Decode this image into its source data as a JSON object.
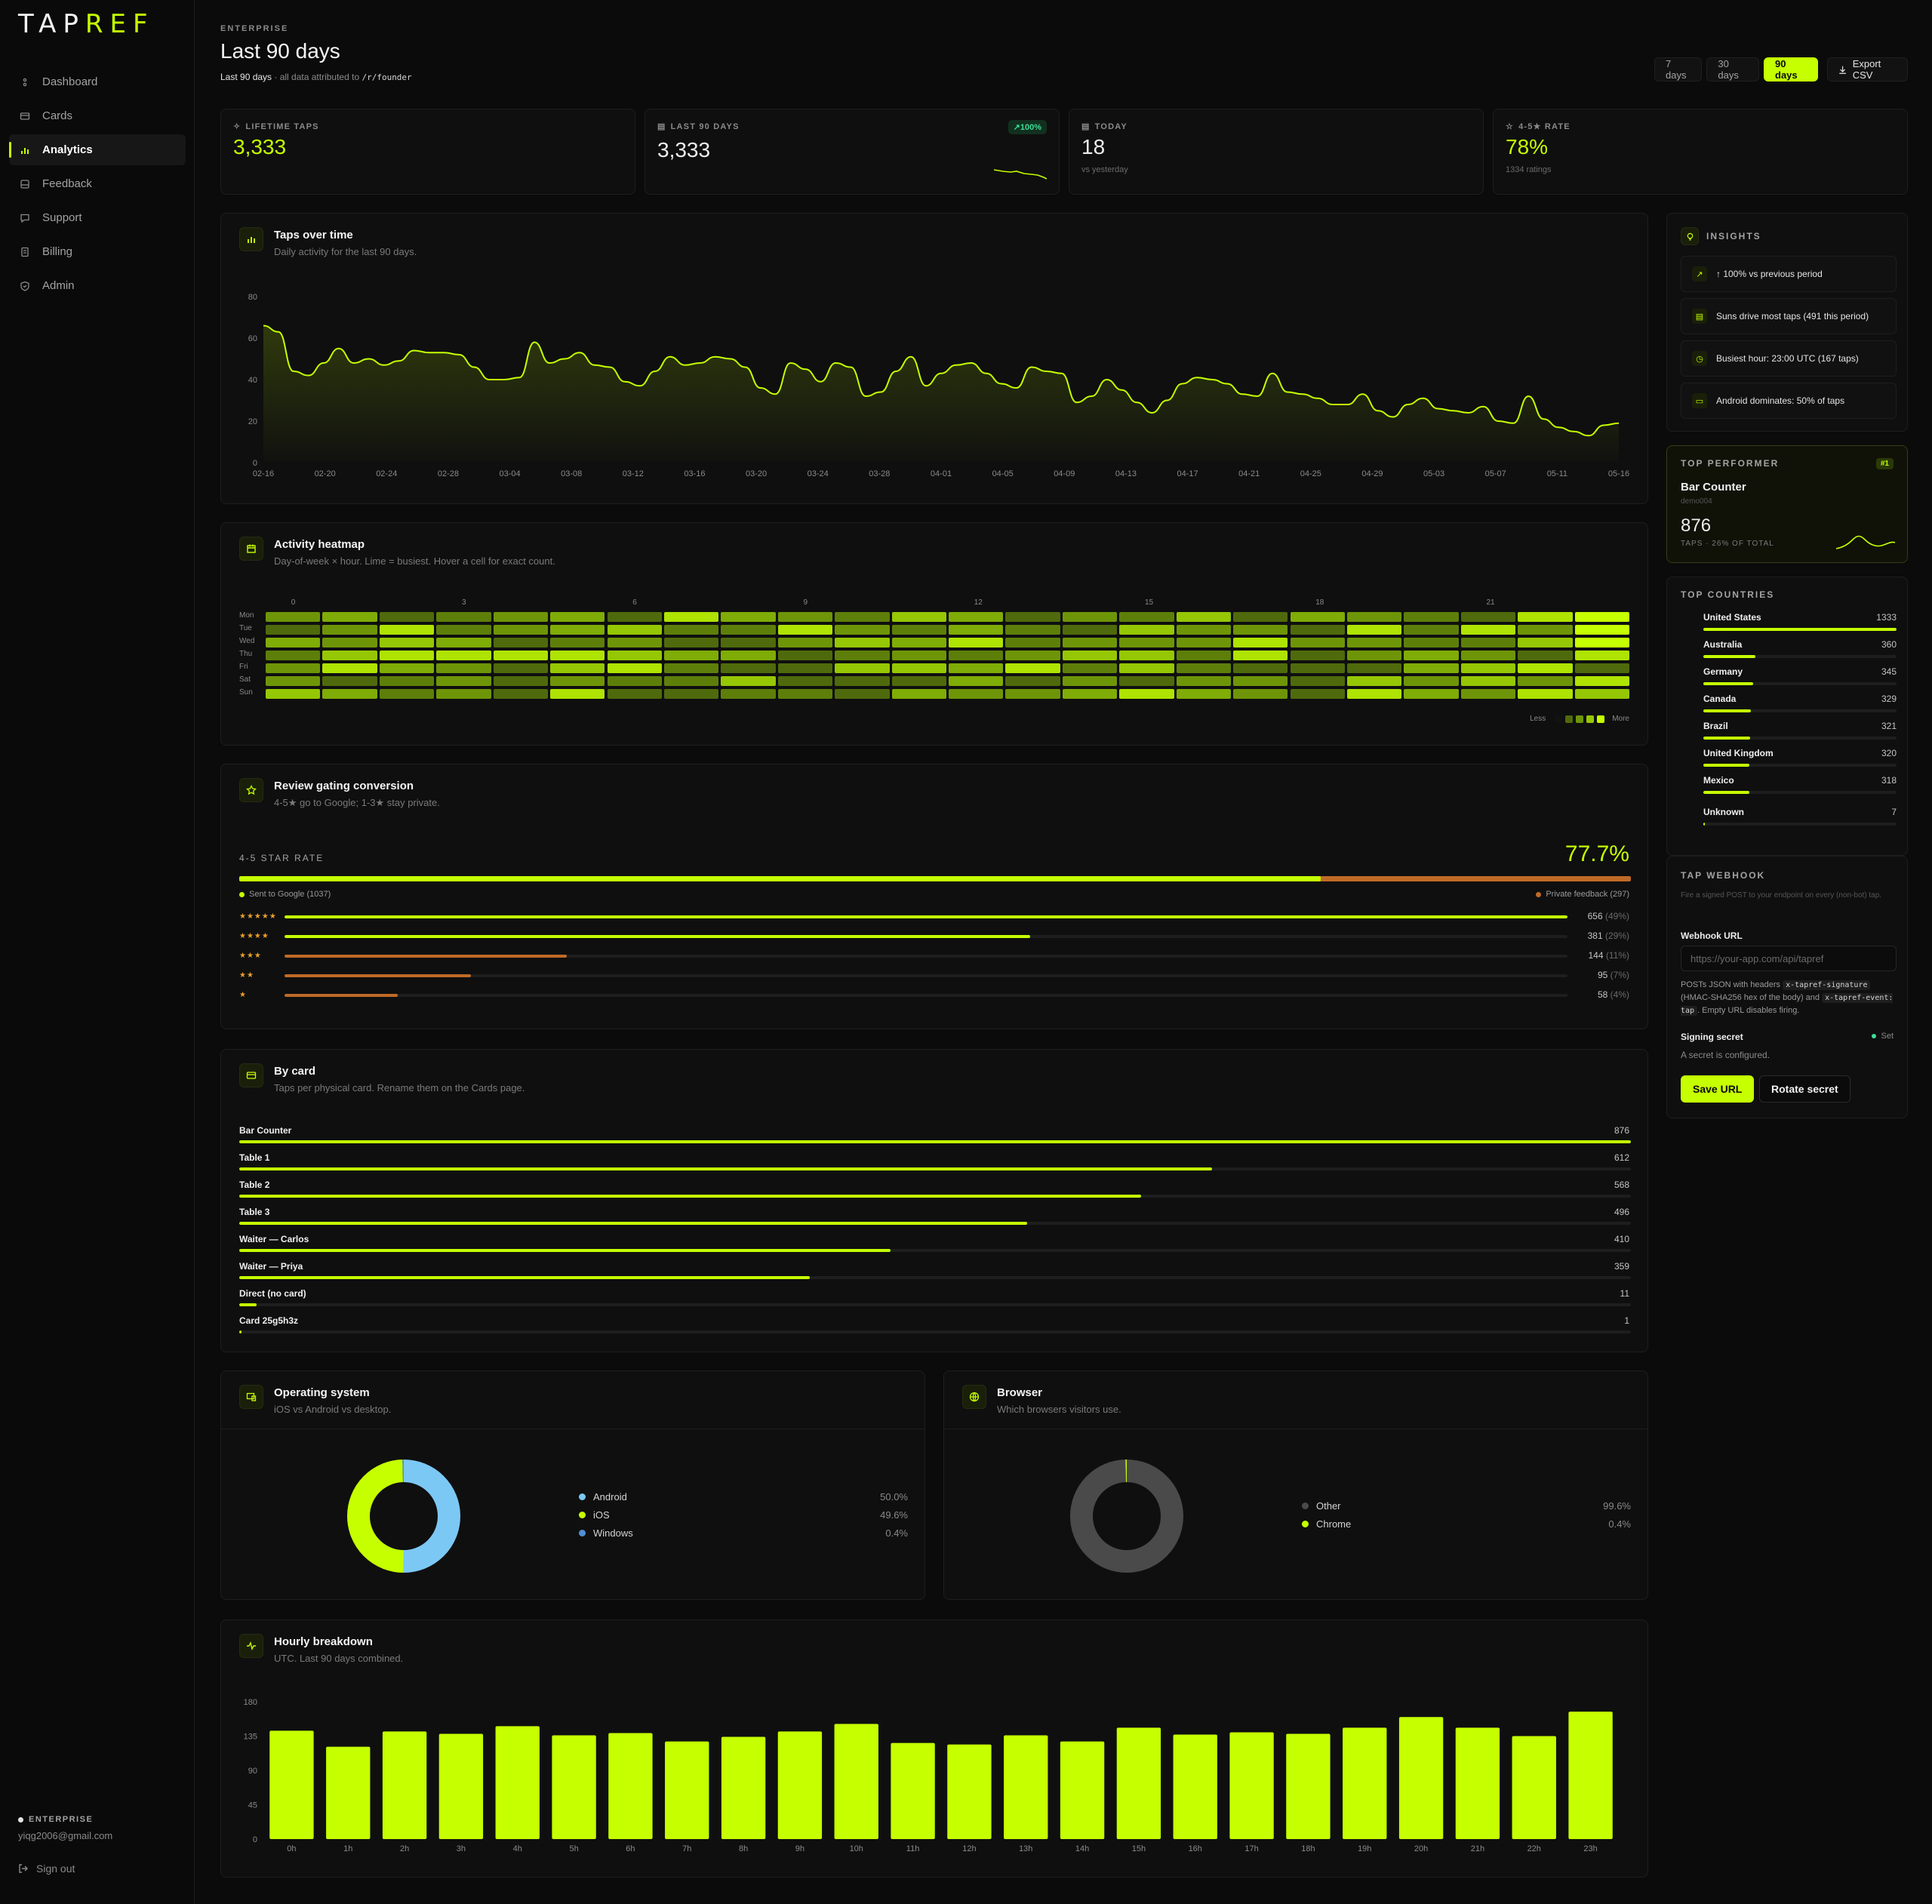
{
  "brand": {
    "logo_a": "TAP",
    "logo_b": "REF"
  },
  "nav": [
    {
      "label": "Dashboard",
      "icon": "dashboard-icon"
    },
    {
      "label": "Cards",
      "icon": "card-icon"
    },
    {
      "label": "Analytics",
      "icon": "bar-chart-icon",
      "active": true
    },
    {
      "label": "Feedback",
      "icon": "feedback-icon"
    },
    {
      "label": "Support",
      "icon": "chat-icon"
    },
    {
      "label": "Billing",
      "icon": "billing-icon"
    },
    {
      "label": "Admin",
      "icon": "shield-icon"
    }
  ],
  "sidebar_footer": {
    "plan": "ENTERPRISE",
    "email": "yiqg2006@gmail.com",
    "signout": "Sign out"
  },
  "header": {
    "eyebrow": "ENTERPRISE",
    "title": "Last 90 days",
    "sub_range": "Last 90 days",
    "sub_mid": " · all data attributed to ",
    "sub_path": "/r/founder"
  },
  "range": {
    "d7": "7 days",
    "d30": "30 days",
    "d90": "90 days",
    "export": "Export CSV"
  },
  "stats": {
    "lifetime": {
      "label": "LIFETIME TAPS",
      "value": "3,333"
    },
    "last90": {
      "label": "LAST 90 DAYS",
      "value": "3,333",
      "badge": "↗100%"
    },
    "today": {
      "label": "TODAY",
      "value": "18",
      "sub": "vs yesterday"
    },
    "rate": {
      "label": "4-5★ RATE",
      "value": "78%",
      "sub": "1334 ratings"
    }
  },
  "taps": {
    "title": "Taps over time",
    "desc": "Daily activity for the last 90 days."
  },
  "heatmap": {
    "title": "Activity heatmap",
    "desc": "Day-of-week × hour. Lime = busiest. Hover a cell for exact count.",
    "days": [
      "Mon",
      "Tue",
      "Wed",
      "Thu",
      "Fri",
      "Sat",
      "Sun"
    ],
    "hour_ticks": [
      "0",
      "3",
      "6",
      "9",
      "12",
      "15",
      "18",
      "21"
    ],
    "less": "Less",
    "more": "More"
  },
  "review": {
    "title": "Review gating conversion",
    "desc": "4-5★ go to Google; 1-3★ stay private.",
    "label": "4-5 STAR RATE",
    "value": "77.7%",
    "google": "Sent to Google (1037)",
    "private": "Private feedback (297)",
    "google_share": 0.777,
    "rows": [
      {
        "stars": "★★★★★",
        "count": "656",
        "pct": "(49%)",
        "share": 1.0,
        "color": "#c5ff00"
      },
      {
        "stars": "★★★★",
        "count": "381",
        "pct": "(29%)",
        "share": 0.581,
        "color": "#c5ff00"
      },
      {
        "stars": "★★★",
        "count": "144",
        "pct": "(11%)",
        "share": 0.22,
        "color": "#c06a26"
      },
      {
        "stars": "★★",
        "count": "95",
        "pct": "(7%)",
        "share": 0.145,
        "color": "#c06a26"
      },
      {
        "stars": "★",
        "count": "58",
        "pct": "(4%)",
        "share": 0.088,
        "color": "#c06a26"
      }
    ]
  },
  "by_card": {
    "title": "By card",
    "desc": "Taps per physical card. Rename them on the Cards page.",
    "rows": [
      {
        "name": "Bar Counter",
        "value": "876",
        "share": 1.0
      },
      {
        "name": "Table 1",
        "value": "612",
        "share": 0.699
      },
      {
        "name": "Table 2",
        "value": "568",
        "share": 0.648
      },
      {
        "name": "Table 3",
        "value": "496",
        "share": 0.566
      },
      {
        "name": "Waiter — Carlos",
        "value": "410",
        "share": 0.468
      },
      {
        "name": "Waiter — Priya",
        "value": "359",
        "share": 0.41
      },
      {
        "name": "Direct (no card)",
        "value": "11",
        "share": 0.0126
      },
      {
        "name": "Card 25g5h3z",
        "value": "1",
        "share": 0.0011
      }
    ]
  },
  "os": {
    "title": "Operating system",
    "desc": "iOS vs Android vs desktop.",
    "items": [
      {
        "name": "Android",
        "pct": "50.0%",
        "share": 0.5,
        "color": "#7cc8f5"
      },
      {
        "name": "iOS",
        "pct": "49.6%",
        "share": 0.496,
        "color": "#c5ff00"
      },
      {
        "name": "Windows",
        "pct": "0.4%",
        "share": 0.004,
        "color": "#4f8fd6"
      }
    ]
  },
  "browser": {
    "title": "Browser",
    "desc": "Which browsers visitors use.",
    "items": [
      {
        "name": "Other",
        "pct": "99.6%",
        "share": 0.996,
        "color": "#4a4a4a"
      },
      {
        "name": "Chrome",
        "pct": "0.4%",
        "share": 0.004,
        "color": "#c5ff00"
      }
    ]
  },
  "hourly": {
    "title": "Hourly breakdown",
    "desc": "UTC. Last 90 days combined."
  },
  "insights": {
    "title": "INSIGHTS",
    "items": [
      "↑ 100% vs previous period",
      "Suns drive most taps (491 this period)",
      "Busiest hour: 23:00 UTC (167 taps)",
      "Android dominates: 50% of taps"
    ]
  },
  "top_performer": {
    "label": "TOP PERFORMER",
    "badge": "#1",
    "name": "Bar Counter",
    "id": "demo004",
    "value": "876",
    "sub": "TAPS · 26% OF TOTAL"
  },
  "countries": {
    "title": "TOP COUNTRIES",
    "items": [
      {
        "name": "United States",
        "count": "1333",
        "share": 1.0
      },
      {
        "name": "Australia",
        "count": "360",
        "share": 0.27
      },
      {
        "name": "Germany",
        "count": "345",
        "share": 0.259
      },
      {
        "name": "Canada",
        "count": "329",
        "share": 0.247
      },
      {
        "name": "Brazil",
        "count": "321",
        "share": 0.241
      },
      {
        "name": "United Kingdom",
        "count": "320",
        "share": 0.24
      },
      {
        "name": "Mexico",
        "count": "318",
        "share": 0.239
      },
      {
        "name": "Unknown",
        "count": "7",
        "share": 0.005
      }
    ]
  },
  "webhook": {
    "title": "TAP WEBHOOK",
    "desc": "Fire a signed POST to your endpoint on every (non-bot) tap.",
    "url_label": "Webhook URL",
    "placeholder": "https://your-app.com/api/tapref",
    "help_a": "POSTs JSON with headers ",
    "help_code1": "x-tapref-signature",
    "help_b": " (HMAC-SHA256 hex of the body) and ",
    "help_code2": "x-tapref-event: tap",
    "help_c": ". Empty URL disables firing.",
    "secret_label": "Signing secret",
    "secret_status": "Set",
    "secret_desc": "A secret is configured.",
    "save": "Save URL",
    "rotate": "Rotate secret"
  },
  "chart_data": [
    {
      "type": "area",
      "title": "Taps over time",
      "x_ticks": [
        "02-16",
        "02-20",
        "02-24",
        "02-28",
        "03-04",
        "03-08",
        "03-12",
        "03-16",
        "03-20",
        "03-24",
        "03-28",
        "04-01",
        "04-05",
        "04-09",
        "04-13",
        "04-17",
        "04-21",
        "04-25",
        "04-29",
        "05-03",
        "05-07",
        "05-11",
        "05-16"
      ],
      "ylim": [
        0,
        80
      ],
      "y_ticks": [
        0,
        20,
        40,
        60,
        80
      ],
      "values": [
        66,
        63,
        44,
        42,
        48,
        55,
        48,
        50,
        47,
        49,
        54,
        53,
        53,
        52,
        46,
        40,
        40,
        41,
        58,
        48,
        50,
        53,
        47,
        46,
        39,
        37,
        44,
        51,
        47,
        48,
        51,
        50,
        46,
        36,
        33,
        48,
        45,
        39,
        48,
        46,
        32,
        34,
        44,
        51,
        37,
        43,
        47,
        48,
        43,
        38,
        36,
        46,
        44,
        43,
        29,
        32,
        40,
        35,
        29,
        24,
        30,
        38,
        41,
        40,
        38,
        33,
        32,
        43,
        34,
        33,
        31,
        28,
        28,
        33,
        25,
        22,
        28,
        31,
        26,
        25,
        24,
        27,
        20,
        19,
        32,
        21,
        17,
        15,
        13,
        18,
        19
      ]
    },
    {
      "type": "bar",
      "title": "Hourly breakdown",
      "categories": [
        "0h",
        "1h",
        "2h",
        "3h",
        "4h",
        "5h",
        "6h",
        "7h",
        "8h",
        "9h",
        "10h",
        "11h",
        "12h",
        "13h",
        "14h",
        "15h",
        "16h",
        "17h",
        "18h",
        "19h",
        "20h",
        "21h",
        "22h",
        "23h"
      ],
      "values": [
        142,
        121,
        141,
        138,
        148,
        136,
        139,
        128,
        134,
        141,
        151,
        126,
        124,
        136,
        128,
        146,
        137,
        140,
        138,
        146,
        160,
        146,
        135,
        167
      ],
      "ylim": [
        0,
        180
      ],
      "y_ticks": [
        0,
        45,
        90,
        135,
        180
      ]
    },
    {
      "type": "heatmap",
      "title": "Activity heatmap",
      "rows": [
        "Mon",
        "Tue",
        "Wed",
        "Thu",
        "Fri",
        "Sat",
        "Sun"
      ],
      "cols": 24
    }
  ]
}
